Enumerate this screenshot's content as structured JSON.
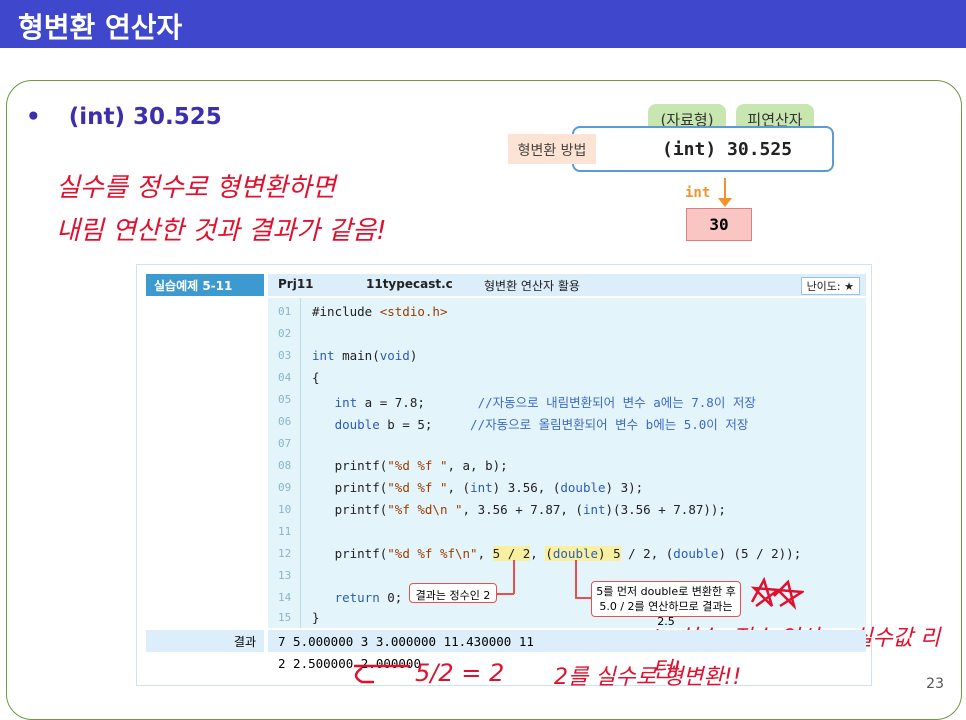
{
  "title": "형변환 연산자",
  "bullet": {
    "dot": "•",
    "text": "(int) 30.525"
  },
  "handwriting": {
    "line1": "실수를 정수로 형변환하면",
    "line2": "내림 연산한 것과 결과가 같음!",
    "line3": "↳ 실수, 정수 연산 → 실수값 리턴!",
    "line4": "5/2 = 2",
    "line5": "2를 실수로 형변환!!"
  },
  "diagram": {
    "chip1": "(자료형)",
    "chip2": "피연산자",
    "method": "형변환 방법",
    "expr": "(int)  30.525",
    "int_label": "int",
    "result": "30"
  },
  "example": {
    "label": "실습예제 5-11",
    "project": "Prj11",
    "file": "11typecast.c",
    "desc": "형변환 연산자 활용",
    "level": "난이도: ★",
    "line_numbers": [
      "01",
      "02",
      "03",
      "04",
      "05",
      "06",
      "07",
      "08",
      "09",
      "10",
      "11",
      "12",
      "13",
      "14",
      "15"
    ],
    "callout1": "결과는 정수인 2",
    "callout2_l1": "5를 먼저 double로 변환한 후",
    "callout2_l2": "5.0 / 2를 연산하므로 결과는 2.5",
    "result_label": "결과",
    "result_line1": "7 5.000000 3 3.000000 11.430000 11",
    "result_line2": "2 2.500000 2.000000"
  },
  "colors": {
    "title_bg": "#3f48cc",
    "hand": "#e0102e",
    "accent": "#3d9ad1"
  },
  "page_number": "23"
}
